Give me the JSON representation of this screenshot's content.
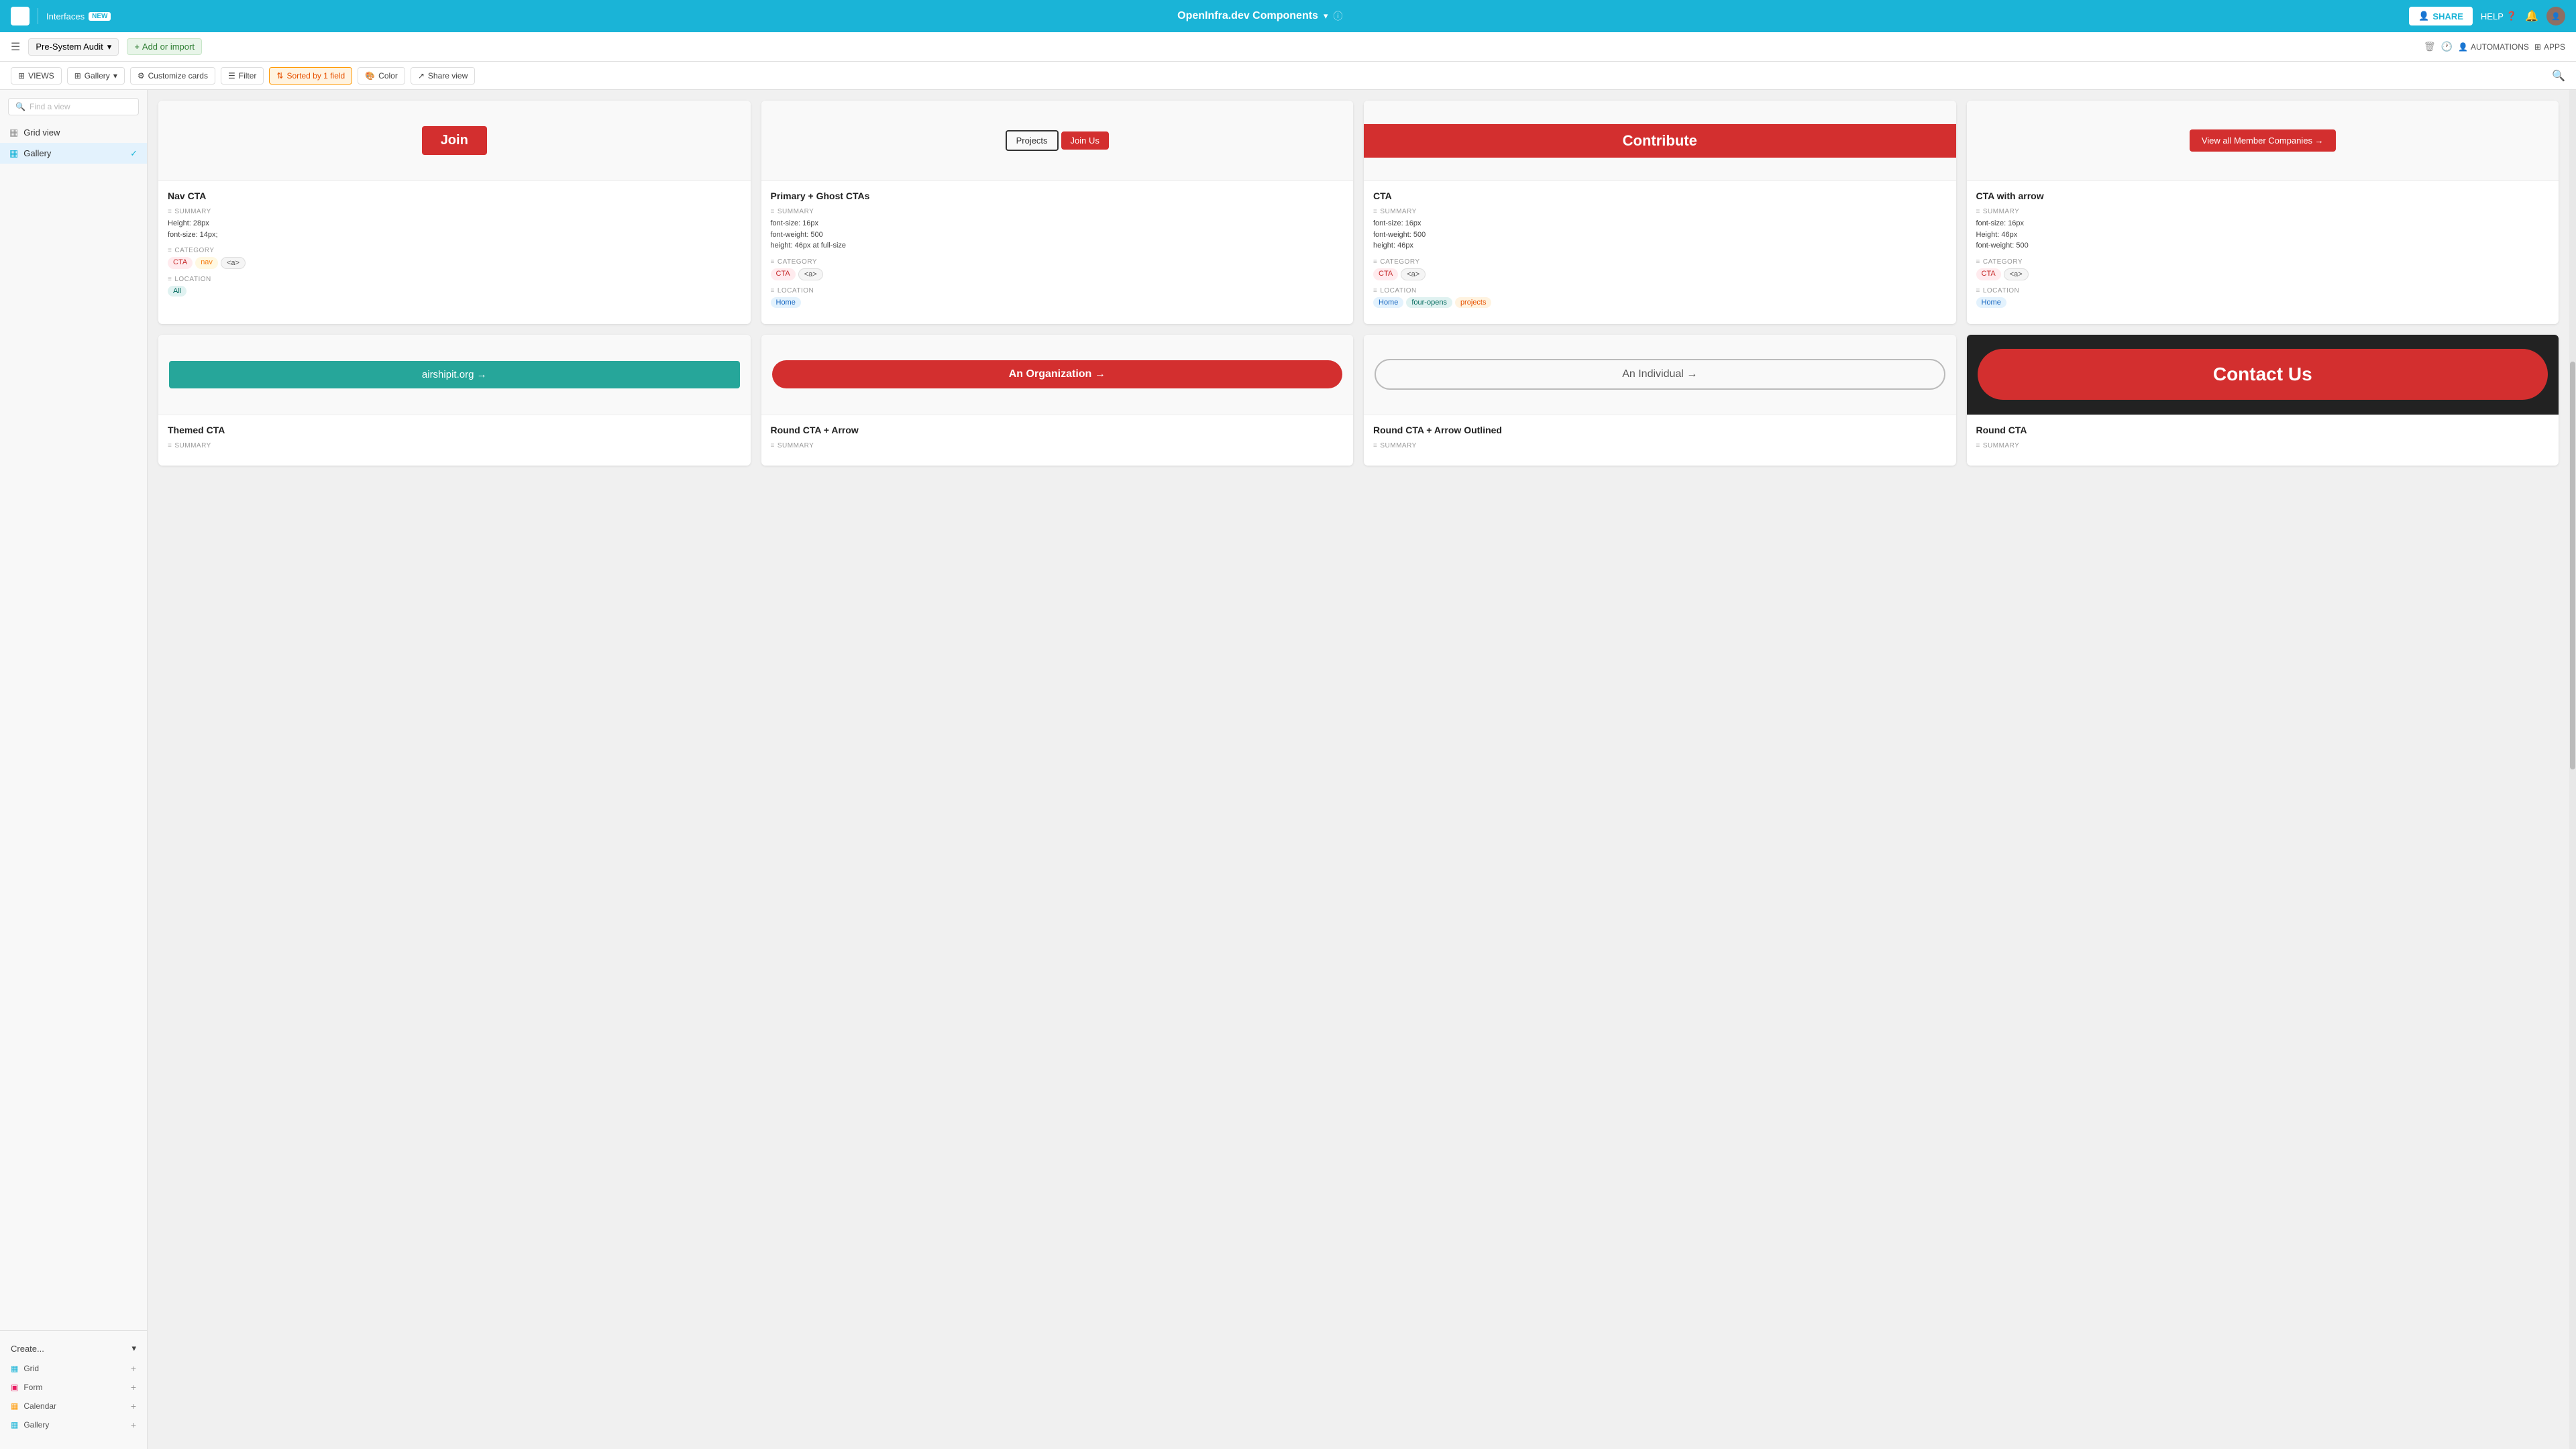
{
  "topbar": {
    "logo_text": "⬡",
    "interfaces_label": "Interfaces",
    "new_badge": "NEW",
    "title": "OpenInfra.dev Components",
    "share_label": "SHARE",
    "help_label": "HELP",
    "view_name": "Pre-System Audit"
  },
  "secondbar": {
    "add_import_label": "Add or import",
    "automations_label": "AUTOMATIONS",
    "apps_label": "APPS"
  },
  "toolbar": {
    "views_label": "VIEWS",
    "gallery_label": "Gallery",
    "customize_label": "Customize cards",
    "filter_label": "Filter",
    "sorted_label": "Sorted by 1 field",
    "color_label": "Color",
    "share_view_label": "Share view"
  },
  "sidebar": {
    "search_placeholder": "Find a view",
    "grid_view_label": "Grid view",
    "gallery_label": "Gallery",
    "create_label": "Create...",
    "create_items": [
      {
        "label": "Grid",
        "icon": "▦"
      },
      {
        "label": "Form",
        "icon": "▣"
      },
      {
        "label": "Calendar",
        "icon": "▦"
      },
      {
        "label": "Gallery",
        "icon": "▦"
      }
    ]
  },
  "cards": [
    {
      "id": "card-1",
      "title": "Nav CTA",
      "summary_label": "SUMMARY",
      "summary": "Height: 28px\nfont-size: 14px;",
      "category_label": "CATEGORY",
      "categories": [
        "CTA",
        "nav",
        "<a>"
      ],
      "location_label": "LOCATION",
      "locations": [
        "All"
      ],
      "preview_type": "join-btn"
    },
    {
      "id": "card-2",
      "title": "Primary + Ghost CTAs",
      "summary_label": "SUMMARY",
      "summary": "font-size: 16px\nfont-weight: 500\nheight: 46px at full-size",
      "category_label": "CATEGORY",
      "categories": [
        "CTA",
        "<a>"
      ],
      "location_label": "LOCATION",
      "locations": [
        "Home"
      ],
      "preview_type": "primary-ghost"
    },
    {
      "id": "card-3",
      "title": "CTA",
      "summary_label": "SUMMARY",
      "summary": "font-size: 16px\nfont-weight: 500\nheight: 46px",
      "category_label": "CATEGORY",
      "categories": [
        "CTA",
        "<a>"
      ],
      "location_label": "LOCATION",
      "locations": [
        "Home",
        "four-opens",
        "projects"
      ],
      "preview_type": "contribute"
    },
    {
      "id": "card-4",
      "title": "CTA with arrow",
      "summary_label": "SUMMARY",
      "summary": "font-size: 16px\nHeight: 46px\nfont-weight: 500",
      "category_label": "CATEGORY",
      "categories": [
        "CTA",
        "<a>"
      ],
      "location_label": "LOCATION",
      "locations": [
        "Home"
      ],
      "preview_type": "view-all"
    },
    {
      "id": "card-5",
      "title": "Themed CTA",
      "summary_label": "SUMMARY",
      "summary": "",
      "category_label": "CATEGORY",
      "categories": [],
      "location_label": "LOCATION",
      "locations": [],
      "preview_type": "airship"
    },
    {
      "id": "card-6",
      "title": "Round CTA + Arrow",
      "summary_label": "SUMMARY",
      "summary": "",
      "category_label": "CATEGORY",
      "categories": [],
      "location_label": "LOCATION",
      "locations": [],
      "preview_type": "org"
    },
    {
      "id": "card-7",
      "title": "Round CTA + Arrow Outlined",
      "summary_label": "SUMMARY",
      "summary": "",
      "category_label": "CATEGORY",
      "categories": [],
      "location_label": "LOCATION",
      "locations": [],
      "preview_type": "individual"
    },
    {
      "id": "card-8",
      "title": "Round CTA",
      "summary_label": "SUMMARY",
      "summary": "",
      "category_label": "CATEGORY",
      "categories": [],
      "location_label": "LOCATION",
      "locations": [],
      "preview_type": "contact"
    }
  ],
  "icons": {
    "search": "🔍",
    "grid": "▦",
    "gallery_icon": "⊞",
    "check": "✓",
    "chevron_down": "▾",
    "plus": "+",
    "share_person": "👤",
    "info": "ⓘ",
    "bell": "🔔",
    "trash": "🗑",
    "clock": "🕐",
    "person": "👤",
    "apps": "⊞",
    "arrow": "→"
  }
}
